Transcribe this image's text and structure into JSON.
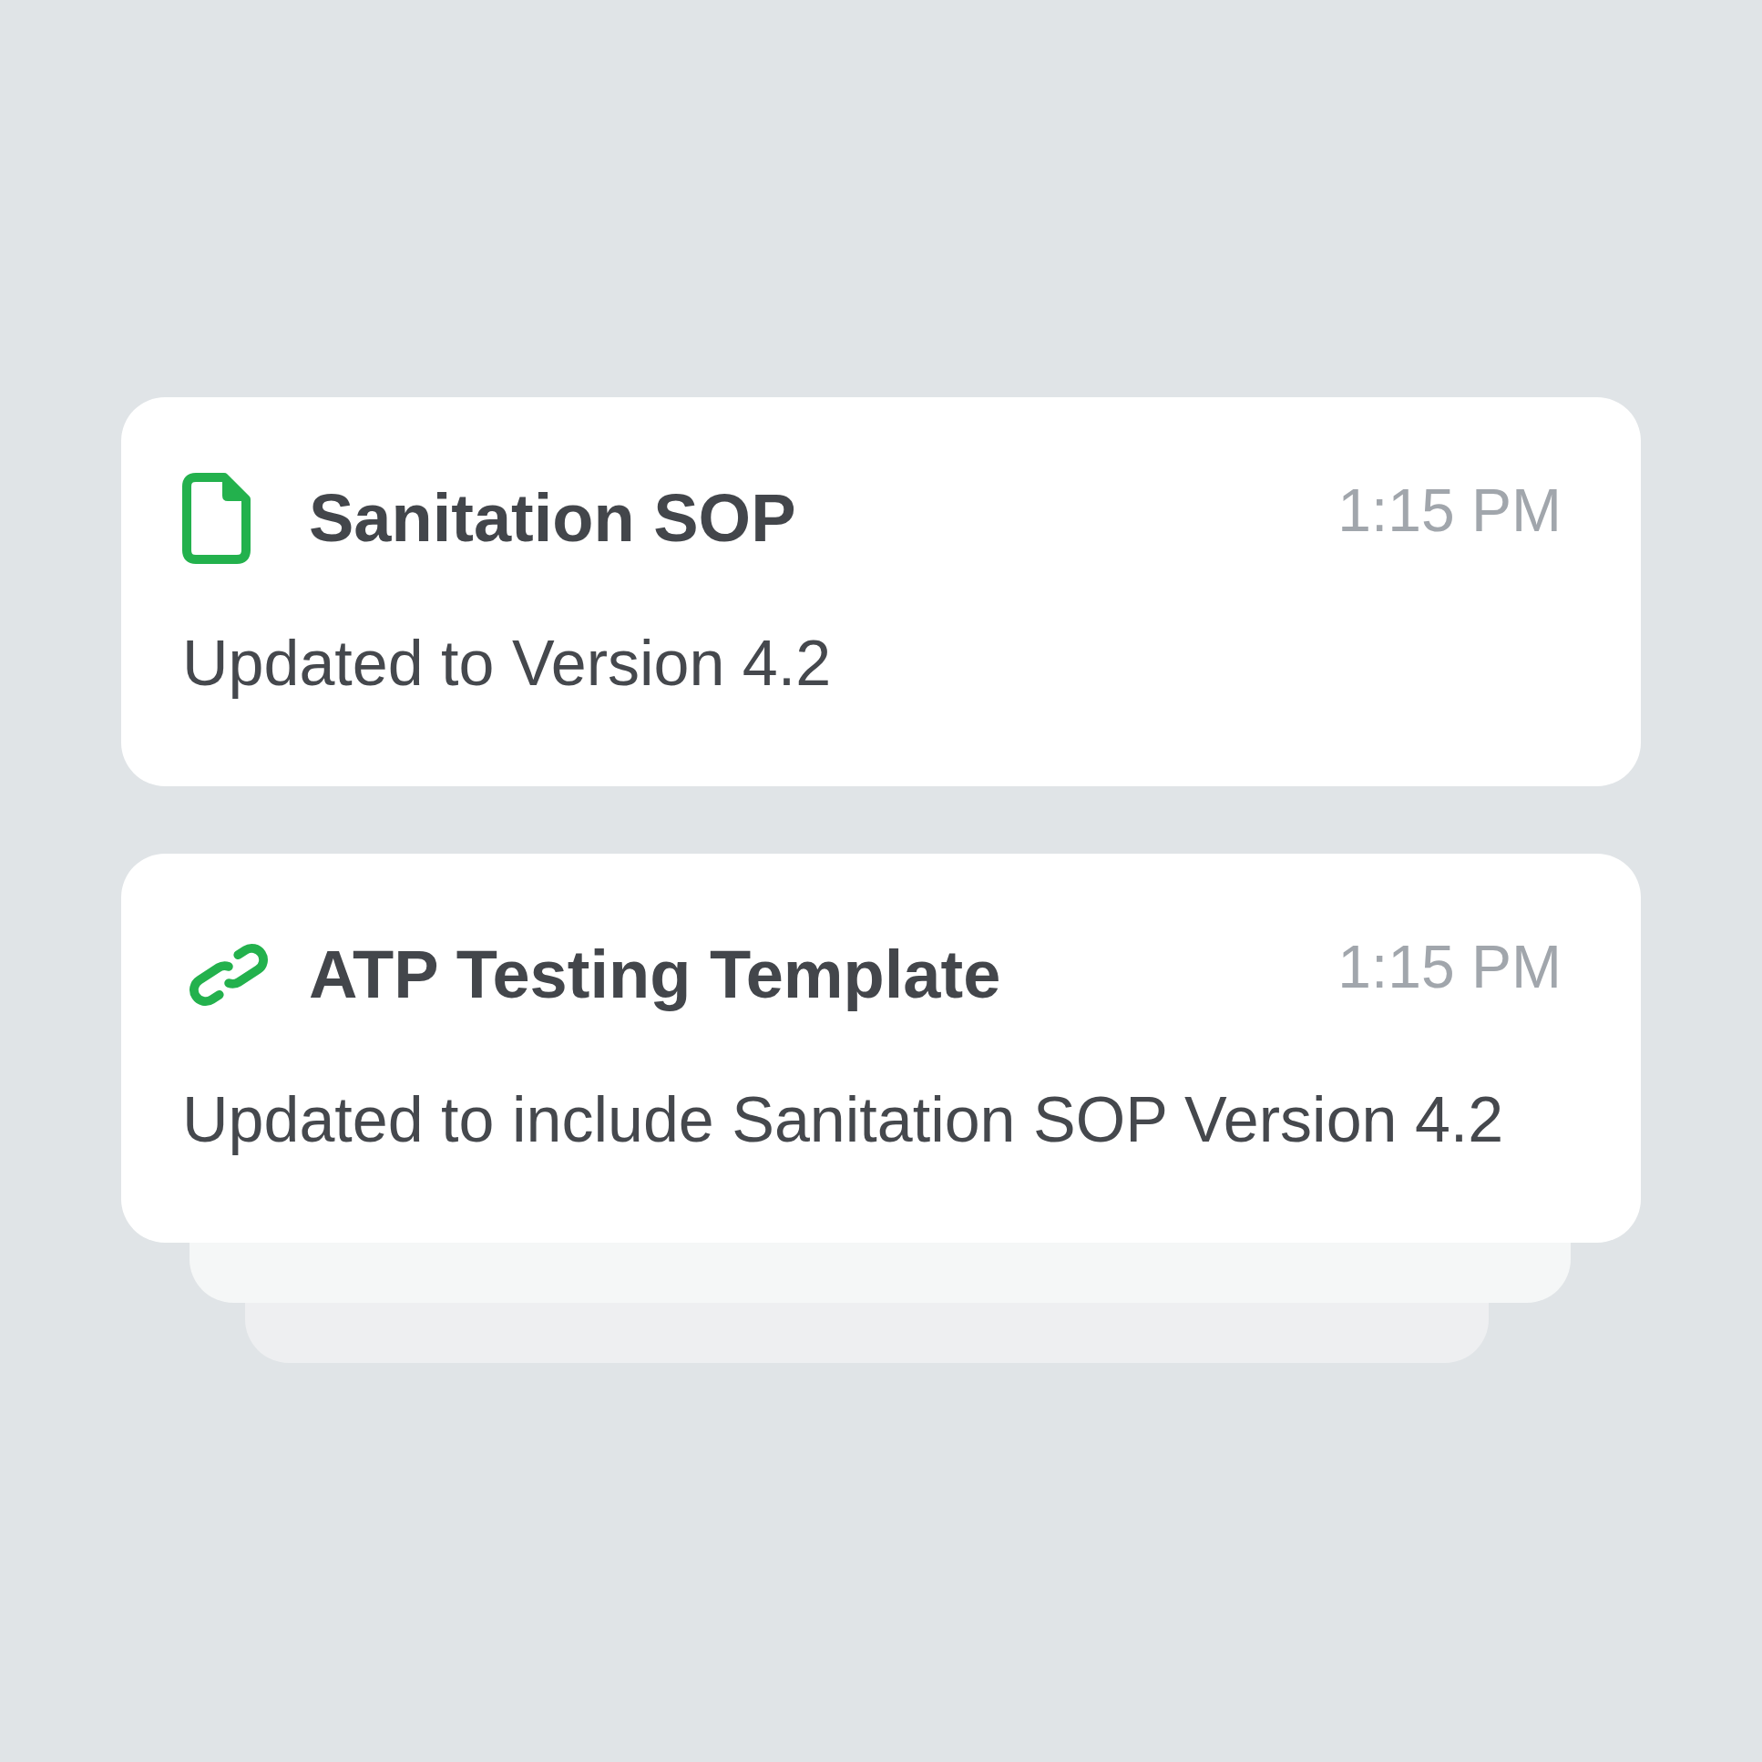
{
  "notifications": [
    {
      "kind": "document",
      "title": "Sanitation SOP",
      "time": "1:15 PM",
      "message": "Updated to Version 4.2"
    },
    {
      "kind": "link",
      "title": "ATP Testing Template",
      "time": "1:15 PM",
      "message": "Updated to include Sanitation SOP Version 4.2"
    }
  ]
}
